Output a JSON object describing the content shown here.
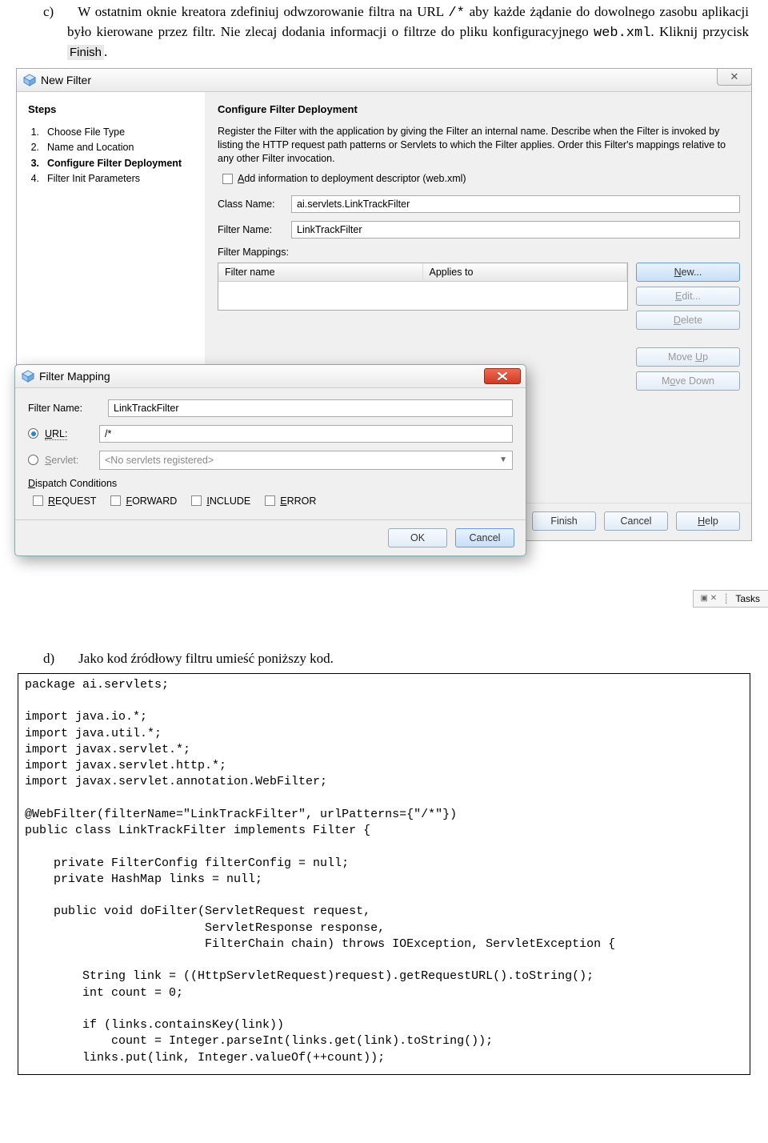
{
  "instruction_c": {
    "marker": "c)",
    "text1": "W ostatnim oknie kreatora zdefiniuj odwzorowanie filtra na URL ",
    "url": "/*",
    "text2": " aby każde żądanie do dowolnego zasobu aplikacji było kierowane przez filtr. Nie zlecaj dodania informacji o filtrze do pliku konfiguracyjnego ",
    "webxml": "web.xml",
    "text3": ". Kliknij przycisk ",
    "finish": "Finish",
    "dot": "."
  },
  "wizard": {
    "title": "New Filter",
    "steps_heading": "Steps",
    "steps": [
      {
        "num": "1.",
        "label": "Choose File Type",
        "bold": false
      },
      {
        "num": "2.",
        "label": "Name and Location",
        "bold": false
      },
      {
        "num": "3.",
        "label": "Configure Filter Deployment",
        "bold": true
      },
      {
        "num": "4.",
        "label": "Filter Init Parameters",
        "bold": false
      }
    ],
    "content_heading": "Configure Filter Deployment",
    "desc": "Register the Filter with the application by giving the Filter an internal name. Describe when the Filter is invoked by listing the HTTP request path patterns or Servlets to which the Filter applies. Order this Filter's mappings relative to any other Filter invocation.",
    "add_info_prefix": "A",
    "add_info_rest": "dd information to deployment descriptor (web.xml)",
    "class_name_label": "Class Name:",
    "class_name_value": "ai.servlets.LinkTrackFilter",
    "filter_name_label": "Filter Name:",
    "filter_name_value": "LinkTrackFilter",
    "mappings_label": "Filter Mappings:",
    "col1": "Filter name",
    "col2": "Applies to",
    "btn_new_u": "N",
    "btn_new_rest": "ew...",
    "btn_edit_u": "E",
    "btn_edit_rest": "dit...",
    "btn_delete_u": "D",
    "btn_delete_rest": "elete",
    "btn_moveup_pre": "Move ",
    "btn_moveup_u": "U",
    "btn_moveup_rest": "p",
    "btn_movedown_pre": "M",
    "btn_movedown_u": "o",
    "btn_movedown_rest": "ve Down",
    "bottom": {
      "finish": "Finish",
      "cancel": "Cancel",
      "help": "Help"
    }
  },
  "modal": {
    "title": "Filter Mapping",
    "filter_name_label": "Filter Name:",
    "filter_name_value": "LinkTrackFilter",
    "url_u": "U",
    "url_rest": "RL:",
    "url_value": "/*",
    "servlet_u": "S",
    "servlet_rest": "ervlet:",
    "servlet_placeholder": "<No servlets registered>",
    "dispatch_u": "D",
    "dispatch_rest": "ispatch Conditions",
    "req_u": "R",
    "req_rest": "EQUEST",
    "fwd_u": "F",
    "fwd_rest": "ORWARD",
    "inc_u": "I",
    "inc_rest": "NCLUDE",
    "err_u": "E",
    "err_rest": "RROR",
    "ok": "OK",
    "cancel": "Cancel"
  },
  "tasks_label": "Tasks",
  "instruction_d": {
    "marker": "d)",
    "text": "Jako kod źródłowy filtru umieść poniższy kod."
  },
  "code": "package ai.servlets;\n\nimport java.io.*;\nimport java.util.*;\nimport javax.servlet.*;\nimport javax.servlet.http.*;\nimport javax.servlet.annotation.WebFilter;\n\n@WebFilter(filterName=\"LinkTrackFilter\", urlPatterns={\"/*\"})\npublic class LinkTrackFilter implements Filter {\n\n    private FilterConfig filterConfig = null;\n    private HashMap links = null;\n\n    public void doFilter(ServletRequest request,\n                         ServletResponse response,\n                         FilterChain chain) throws IOException, ServletException {\n\n        String link = ((HttpServletRequest)request).getRequestURL().toString();\n        int count = 0;\n\n        if (links.containsKey(link))\n            count = Integer.parseInt(links.get(link).toString());\n        links.put(link, Integer.valueOf(++count));"
}
